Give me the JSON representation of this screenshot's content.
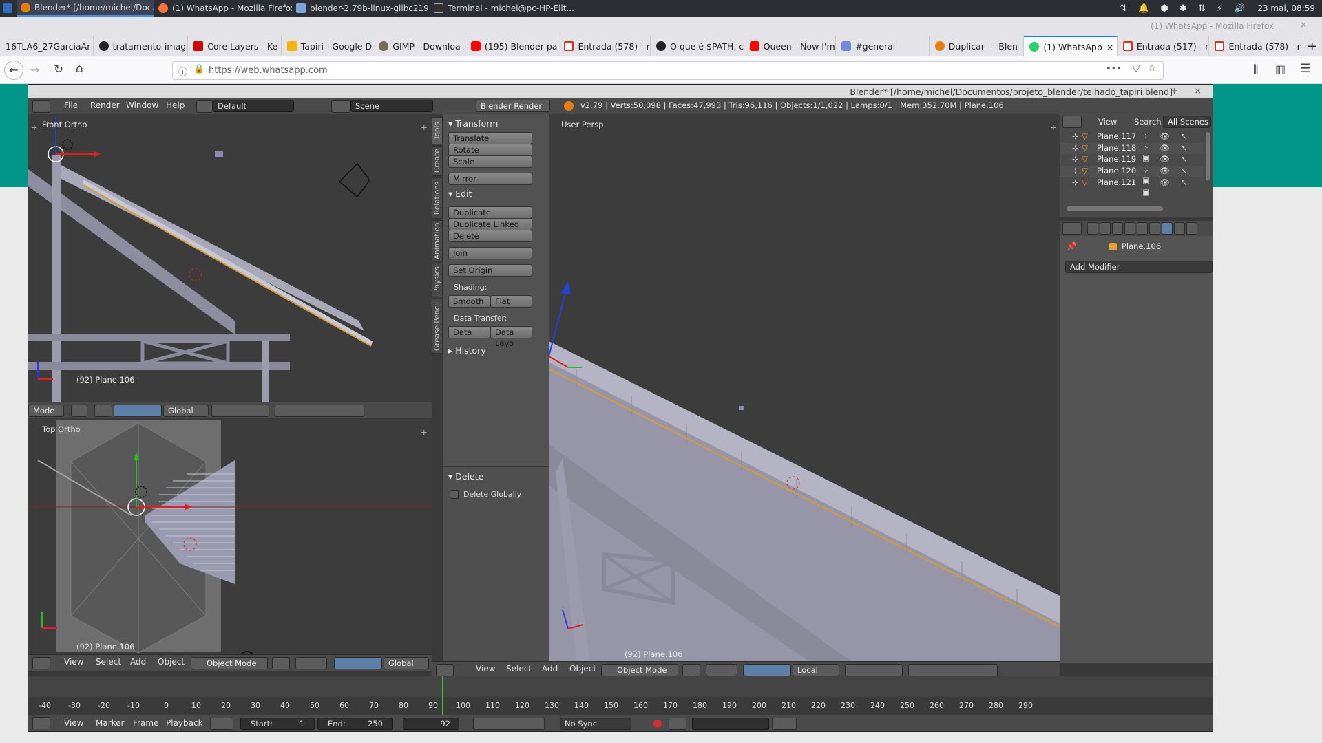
{
  "system_bar": {
    "tasks": [
      {
        "label": "Blender* [/home/michel/Doc...",
        "active": true
      },
      {
        "label": "(1) WhatsApp - Mozilla Firefox",
        "active": false
      },
      {
        "label": "blender-2.79b-linux-glibc219...",
        "active": false
      },
      {
        "label": "Terminal - michel@pc-HP-Elit...",
        "active": false
      }
    ],
    "clock": "23 mai, 08:59"
  },
  "firefox": {
    "window_title": "(1) WhatsApp - Mozilla Firefox",
    "tabs": [
      "16TLA6_27GarciaAr",
      "tratamento-imag",
      "Core Layers - Ke",
      "Tapiri - Google D",
      "GIMP - Downloa",
      "(195) Blender pa",
      "Entrada (578) - n",
      "O que é $PATH, c",
      "Queen - Now I'm",
      "#general",
      "Duplicar — Blen",
      "(1) WhatsApp",
      "Entrada (517) - n",
      "Entrada (578) - n"
    ],
    "active_tab": 11,
    "url": "https://web.whatsapp.com",
    "new_tab": "+"
  },
  "blender": {
    "title": "Blender* [/home/michel/Documentos/projeto_blender/telhado_tapiri.blend]",
    "menu": [
      "File",
      "Render",
      "Window",
      "Help"
    ],
    "layout": "Default",
    "scene": "Scene",
    "engine": "Blender Render",
    "stats": "v2.79 | Verts:50,098 | Faces:47,993 | Tris:96,116 | Objects:1/1,022 | Lamps:0/1 | Mem:352.70M | Plane.106",
    "viewport_front": {
      "label": "Front Ortho",
      "object": "(92) Plane.106",
      "mode": "Mode",
      "orientation": "Global"
    },
    "viewport_top": {
      "label": "Top Ortho",
      "object": "(92) Plane.106",
      "menus": [
        "View",
        "Select",
        "Add",
        "Object"
      ],
      "mode": "Object Mode",
      "orientation": "Global"
    },
    "viewport_persp": {
      "label": "User Persp",
      "object": "(92) Plane.106",
      "menus": [
        "View",
        "Select",
        "Add",
        "Object"
      ],
      "mode": "Object Mode",
      "orientation": "Local"
    },
    "tool_tabs": [
      "Tools",
      "Create",
      "Relations",
      "Animation",
      "Physics",
      "Grease Pencil"
    ],
    "tools": {
      "transform_title": "Transform",
      "transform": [
        "Translate",
        "Rotate",
        "Scale"
      ],
      "mirror": "Mirror",
      "edit_title": "Edit",
      "edit": [
        "Duplicate",
        "Duplicate Linked",
        "Delete"
      ],
      "join": "Join",
      "set_origin": "Set Origin",
      "shading_label": "Shading:",
      "smooth": "Smooth",
      "flat": "Flat",
      "data_transfer_label": "Data Transfer:",
      "data": "Data",
      "data_layout": "Data Layo",
      "history": "History",
      "delete_title": "Delete",
      "delete_globally": "Delete Globally"
    },
    "outliner": {
      "menus": [
        "View",
        "Search"
      ],
      "scope": "All Scenes",
      "items": [
        "Plane.117",
        "Plane.118",
        "Plane.119",
        "Plane.120",
        "Plane.121"
      ]
    },
    "properties": {
      "object": "Plane.106",
      "add_modifier": "Add Modifier"
    },
    "timeline": {
      "ticks": [
        "-40",
        "-30",
        "-20",
        "-10",
        "0",
        "10",
        "20",
        "30",
        "40",
        "50",
        "60",
        "70",
        "80",
        "90",
        "100",
        "110",
        "120",
        "130",
        "140",
        "150",
        "160",
        "170",
        "180",
        "190",
        "200",
        "210",
        "220",
        "230",
        "240",
        "250",
        "260",
        "270",
        "280",
        "290"
      ],
      "menus": [
        "View",
        "Marker",
        "Frame",
        "Playback"
      ],
      "start_label": "Start:",
      "start": "1",
      "end_label": "End:",
      "end": "250",
      "current_frame": "92",
      "sync": "No Sync"
    }
  }
}
